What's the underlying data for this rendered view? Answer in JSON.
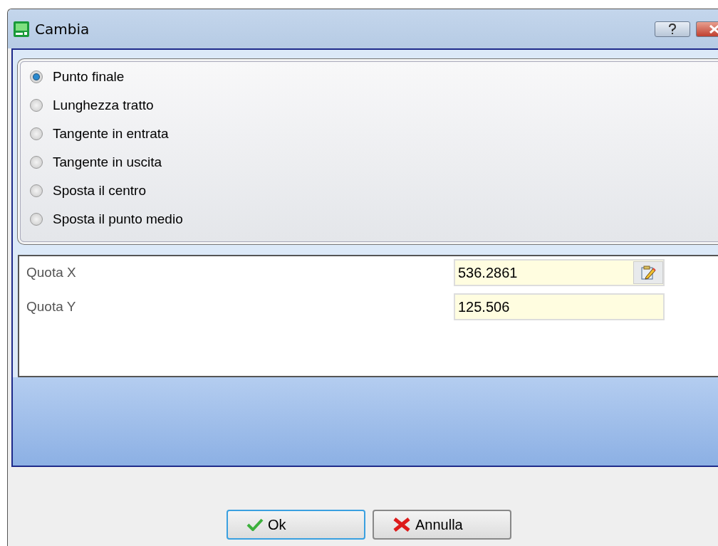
{
  "window": {
    "title": "Cambia"
  },
  "options": [
    {
      "label": "Punto finale",
      "selected": true
    },
    {
      "label": "Lunghezza tratto",
      "selected": false
    },
    {
      "label": "Tangente in entrata",
      "selected": false
    },
    {
      "label": "Tangente in uscita",
      "selected": false
    },
    {
      "label": "Sposta il centro",
      "selected": false
    },
    {
      "label": "Sposta il punto medio",
      "selected": false
    }
  ],
  "fields": [
    {
      "label": "Quota X",
      "value": "536.2861",
      "kind": "edit"
    },
    {
      "label": "Quota Y",
      "value": "125.506",
      "kind": "plain"
    }
  ],
  "buttons": [
    {
      "label": "Ok",
      "kind": "ok"
    },
    {
      "label": "Annulla",
      "kind": "cancel"
    }
  ]
}
